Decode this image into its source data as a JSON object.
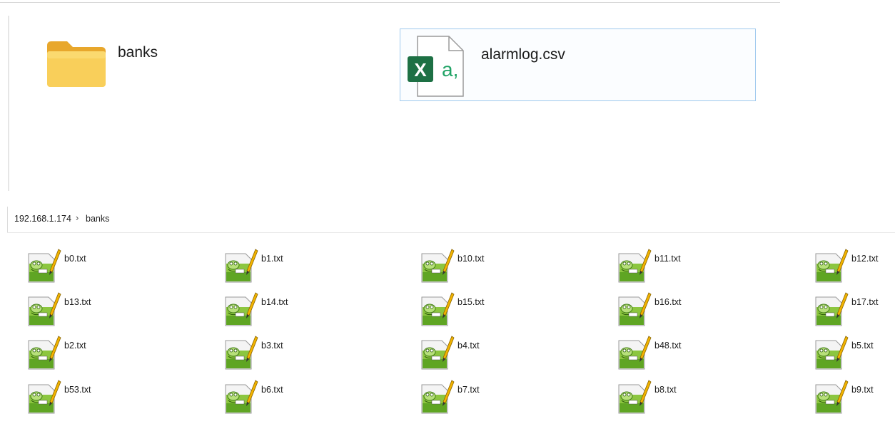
{
  "top_pane": {
    "items": [
      {
        "name": "banks",
        "kind": "folder"
      },
      {
        "name": "alarmlog.csv",
        "kind": "excel-csv"
      }
    ]
  },
  "breadcrumb": {
    "segments": [
      "192.168.1.174",
      "banks"
    ],
    "separator": ">"
  },
  "files": [
    {
      "name": "b0.txt"
    },
    {
      "name": "b1.txt"
    },
    {
      "name": "b10.txt"
    },
    {
      "name": "b11.txt"
    },
    {
      "name": "b12.txt"
    },
    {
      "name": "b13.txt"
    },
    {
      "name": "b14.txt"
    },
    {
      "name": "b15.txt"
    },
    {
      "name": "b16.txt"
    },
    {
      "name": "b17.txt"
    },
    {
      "name": "b2.txt"
    },
    {
      "name": "b3.txt"
    },
    {
      "name": "b4.txt"
    },
    {
      "name": "b48.txt"
    },
    {
      "name": "b5.txt"
    },
    {
      "name": "b53.txt"
    },
    {
      "name": "b6.txt"
    },
    {
      "name": "b7.txt"
    },
    {
      "name": "b8.txt"
    },
    {
      "name": "b9.txt"
    }
  ],
  "icons": {
    "folder": "folder-icon",
    "csv": "excel-csv-file-icon",
    "txt": "notepad-plus-plus-file-icon"
  },
  "colors": {
    "folder_yellow": "#f6c44e",
    "excel_green": "#1d7044",
    "selection_border": "#9fc9ee",
    "notepad_green": "#8cc63f"
  }
}
